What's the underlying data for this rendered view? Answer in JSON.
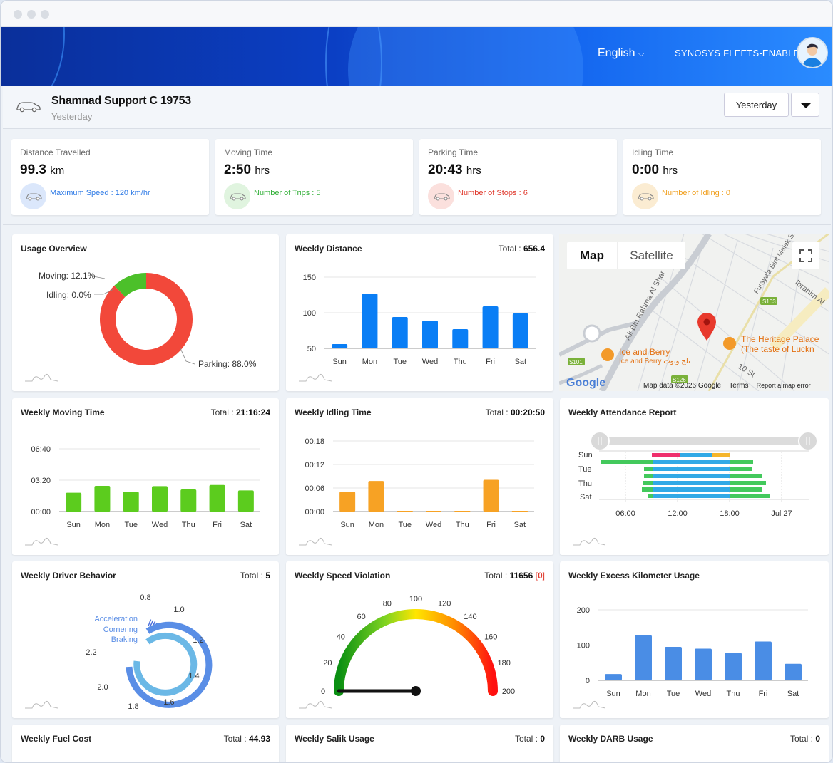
{
  "header": {
    "language": "English",
    "fleet_name": "SYNOSYS FLEETS-ENABLED"
  },
  "vehicle": {
    "name": "Shamnad Support C 19753",
    "period": "Yesterday",
    "period_button": "Yesterday"
  },
  "stats": [
    {
      "label": "Distance Travelled",
      "value": "99.3",
      "unit": "km",
      "sub": "Maximum Speed : 120 km/hr",
      "color": "#2f7be6",
      "icon_bg": "#dbe7fb"
    },
    {
      "label": "Moving Time",
      "value": "2:50",
      "unit": "hrs",
      "sub": "Number of Trips : 5",
      "color": "#34b03a",
      "icon_bg": "#e0f4df"
    },
    {
      "label": "Parking Time",
      "value": "20:43",
      "unit": "hrs",
      "sub": "Number of Stops : 6",
      "color": "#e03a2e",
      "icon_bg": "#fbe0dd"
    },
    {
      "label": "Idling Time",
      "value": "0:00",
      "unit": "hrs",
      "sub": "Number of Idling : 0",
      "color": "#f0a020",
      "icon_bg": "#fbecd2"
    }
  ],
  "cards": {
    "usage": {
      "title": "Usage Overview"
    },
    "weekly_distance": {
      "title": "Weekly Distance",
      "total_label": "Total :",
      "total": "656.4"
    },
    "weekly_moving": {
      "title": "Weekly Moving Time",
      "total_label": "Total :",
      "total": "21:16:24"
    },
    "weekly_idling": {
      "title": "Weekly Idling Time",
      "total_label": "Total :",
      "total": "00:20:50"
    },
    "attendance": {
      "title": "Weekly Attendance Report"
    },
    "driver": {
      "title": "Weekly Driver Behavior",
      "total_label": "Total :",
      "total": "5"
    },
    "speed": {
      "title": "Weekly Speed Violation",
      "total_label": "Total :",
      "total": "11656",
      "total_extra": "0"
    },
    "excess": {
      "title": "Weekly Excess Kilometer Usage"
    },
    "fuel": {
      "title": "Weekly Fuel Cost",
      "total_label": "Total :",
      "total": "44.93"
    },
    "salik": {
      "title": "Weekly Salik Usage",
      "total_label": "Total :",
      "total": "0"
    },
    "darb": {
      "title": "Weekly DARB Usage",
      "total_label": "Total :",
      "total": "0"
    }
  },
  "map": {
    "tab_map": "Map",
    "tab_satellite": "Satellite",
    "footer_data": "Map data ©2026 Google",
    "footer_terms": "Terms",
    "footer_report": "Report a map error",
    "labels": [
      "The Heritage Palace",
      "(The taste of Luckn",
      "Ice and Berry",
      "Ice and Berry تلج وتوت",
      "Ali Bin Rahma Al Shar",
      "Furaya'a Bint Malek St",
      "Ibrahim Al",
      "S103",
      "S101",
      "S126",
      "10 St",
      "Google"
    ]
  },
  "chart_data": [
    {
      "type": "pie",
      "title": "Usage Overview",
      "labels": [
        "Moving",
        "Idling",
        "Parking"
      ],
      "values": [
        12.1,
        0.0,
        88.0
      ],
      "label_text": [
        "Moving: 12.1%",
        "Idling: 0.0%",
        "Parking: 88.0%"
      ],
      "colors": [
        "#4cc02a",
        "#2f7be6",
        "#f2483a"
      ]
    },
    {
      "type": "bar",
      "title": "Weekly Distance",
      "categories": [
        "Sun",
        "Mon",
        "Tue",
        "Wed",
        "Thu",
        "Fri",
        "Sat"
      ],
      "values": [
        56,
        127,
        94,
        89,
        77,
        109,
        99
      ],
      "ylim": [
        50,
        150
      ],
      "yticks": [
        "50",
        "100",
        "150"
      ],
      "color": "#0a7ef5"
    },
    {
      "type": "bar",
      "title": "Weekly Moving Time",
      "categories": [
        "Sun",
        "Mon",
        "Tue",
        "Wed",
        "Thu",
        "Fri",
        "Sat"
      ],
      "values": [
        2.0,
        2.73,
        2.1,
        2.7,
        2.35,
        2.82,
        2.25
      ],
      "ylim": [
        0,
        6.67
      ],
      "yticks": [
        "00:00",
        "03:20",
        "06:40"
      ],
      "color": "#5ccc1e"
    },
    {
      "type": "bar",
      "title": "Weekly Idling Time",
      "categories": [
        "Sun",
        "Mon",
        "Tue",
        "Wed",
        "Thu",
        "Fri",
        "Sat"
      ],
      "values": [
        0.085,
        0.13,
        0,
        0,
        0,
        0.135,
        0
      ],
      "ylim": [
        0,
        0.3
      ],
      "yticks": [
        "00:00",
        "00:06",
        "00:12",
        "00:18"
      ],
      "color": "#f7a224"
    },
    {
      "type": "bar",
      "title": "Weekly Attendance Report",
      "categories": [
        "Sun",
        "Tue",
        "Thu",
        "Sat"
      ],
      "xticks": [
        "06:00",
        "12:00",
        "18:00",
        "Jul 27"
      ]
    },
    {
      "type": "bar",
      "title": "Weekly Driver Behavior",
      "series": [
        {
          "name": "Acceleration"
        },
        {
          "name": "Cornering"
        },
        {
          "name": "Braking"
        }
      ],
      "ticks": [
        "0.8",
        "1.0",
        "1.2",
        "1.4",
        "1.6",
        "1.8",
        "2.0",
        "2.2"
      ]
    },
    {
      "type": "gauge",
      "title": "Weekly Speed Violation",
      "ticks": [
        "0",
        "20",
        "40",
        "60",
        "80",
        "100",
        "120",
        "140",
        "160",
        "180",
        "200"
      ],
      "value": 0
    },
    {
      "type": "bar",
      "title": "Weekly Excess Kilometer Usage",
      "categories": [
        "Sun",
        "Mon",
        "Tue",
        "Wed",
        "Thu",
        "Fri",
        "Sat"
      ],
      "values": [
        18,
        128,
        95,
        90,
        78,
        110,
        47
      ],
      "ylim": [
        0,
        200
      ],
      "yticks": [
        "0",
        "100",
        "200"
      ],
      "color": "#4a8de5"
    }
  ]
}
